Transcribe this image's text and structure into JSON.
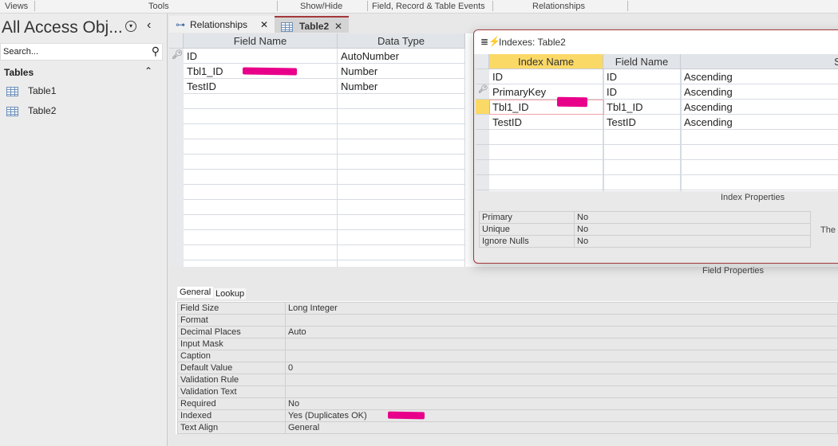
{
  "ribbon": {
    "groups": [
      "Views",
      "Tools",
      "Show/Hide",
      "Field, Record & Table Events",
      "Relationships"
    ]
  },
  "nav": {
    "title": "All Access Obj...",
    "search_placeholder": "Search...",
    "section": "Tables",
    "items": [
      "Table1",
      "Table2"
    ]
  },
  "tabs": [
    {
      "label": "Relationships"
    },
    {
      "label": "Table2"
    }
  ],
  "design": {
    "headers": [
      "Field Name",
      "Data Type"
    ],
    "rows": [
      {
        "name": "ID",
        "type": "AutoNumber",
        "key": true
      },
      {
        "name": "Tbl1_ID",
        "type": "Number"
      },
      {
        "name": "TestID",
        "type": "Number"
      }
    ]
  },
  "field_properties": {
    "label": "Field Properties",
    "tabs": [
      "General",
      "Lookup"
    ],
    "rows": [
      [
        "Field Size",
        "Long Integer"
      ],
      [
        "Format",
        ""
      ],
      [
        "Decimal Places",
        "Auto"
      ],
      [
        "Input Mask",
        ""
      ],
      [
        "Caption",
        ""
      ],
      [
        "Default Value",
        "0"
      ],
      [
        "Validation Rule",
        ""
      ],
      [
        "Validation Text",
        ""
      ],
      [
        "Required",
        "No"
      ],
      [
        "Indexed",
        "Yes (Duplicates OK)"
      ],
      [
        "Text Align",
        "General"
      ]
    ]
  },
  "indexes": {
    "title": "Indexes: Table2",
    "headers": [
      "Index Name",
      "Field Name",
      "So"
    ],
    "rows": [
      [
        "ID",
        "ID",
        "Ascending"
      ],
      [
        "PrimaryKey",
        "ID",
        "Ascending"
      ],
      [
        "Tbl1_ID",
        "Tbl1_ID",
        "Ascending"
      ],
      [
        "TestID",
        "TestID",
        "Ascending"
      ]
    ],
    "properties_label": "Index Properties",
    "properties": [
      [
        "Primary",
        "No"
      ],
      [
        "Unique",
        "No"
      ],
      [
        "Ignore Nulls",
        "No"
      ]
    ],
    "help_text": "The"
  },
  "colors": {
    "accent": "#a4373a",
    "highlight": "#fbd966",
    "redaction": "#e8008a"
  }
}
